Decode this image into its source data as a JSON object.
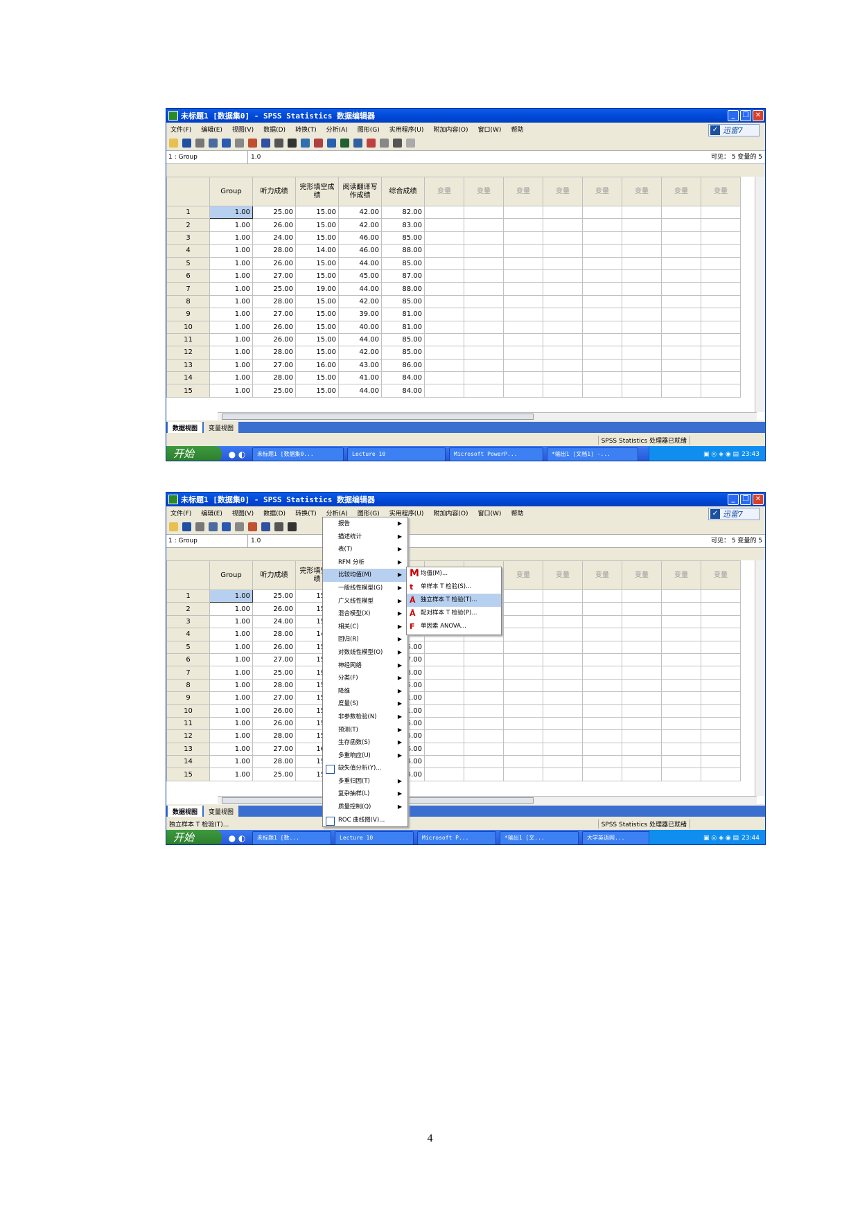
{
  "window": {
    "title": "未标题1 [数据集0] - SPSS Statistics 数据编辑器",
    "menu": [
      "文件(F)",
      "编辑(E)",
      "视图(V)",
      "数据(D)",
      "转换(T)",
      "分析(A)",
      "图形(G)",
      "实用程序(U)",
      "附加内容(O)",
      "窗口(W)",
      "帮助"
    ],
    "brand": "迅雷7",
    "cell_ref": "1 : Group",
    "cell_value": "1.0",
    "visible": "可见： 5 变量的 5",
    "columns": [
      "Group",
      "听力成绩",
      "完形填空成绩",
      "阅读翻译写作成绩",
      "综合成绩"
    ],
    "var_placeholder": "变量",
    "rows": [
      [
        "1",
        "1.00",
        "25.00",
        "15.00",
        "42.00",
        "82.00"
      ],
      [
        "2",
        "1.00",
        "26.00",
        "15.00",
        "42.00",
        "83.00"
      ],
      [
        "3",
        "1.00",
        "24.00",
        "15.00",
        "46.00",
        "85.00"
      ],
      [
        "4",
        "1.00",
        "28.00",
        "14.00",
        "46.00",
        "88.00"
      ],
      [
        "5",
        "1.00",
        "26.00",
        "15.00",
        "44.00",
        "85.00"
      ],
      [
        "6",
        "1.00",
        "27.00",
        "15.00",
        "45.00",
        "87.00"
      ],
      [
        "7",
        "1.00",
        "25.00",
        "19.00",
        "44.00",
        "88.00"
      ],
      [
        "8",
        "1.00",
        "28.00",
        "15.00",
        "42.00",
        "85.00"
      ],
      [
        "9",
        "1.00",
        "27.00",
        "15.00",
        "39.00",
        "81.00"
      ],
      [
        "10",
        "1.00",
        "26.00",
        "15.00",
        "40.00",
        "81.00"
      ],
      [
        "11",
        "1.00",
        "26.00",
        "15.00",
        "44.00",
        "85.00"
      ],
      [
        "12",
        "1.00",
        "28.00",
        "15.00",
        "42.00",
        "85.00"
      ],
      [
        "13",
        "1.00",
        "27.00",
        "16.00",
        "43.00",
        "86.00"
      ],
      [
        "14",
        "1.00",
        "28.00",
        "15.00",
        "41.00",
        "84.00"
      ],
      [
        "15",
        "1.00",
        "25.00",
        "15.00",
        "44.00",
        "84.00"
      ]
    ],
    "tabs": [
      "数据视图",
      "变量视图"
    ],
    "status_ready": "SPSS Statistics  处理器已就绪",
    "start": "开始"
  },
  "screen1": {
    "status_left": "",
    "tasks": [
      "未标题1 [数据集0...",
      "Lecture 10",
      "Microsoft PowerP...",
      "*输出1 [文档1] -..."
    ],
    "clock": "23:43"
  },
  "screen2": {
    "status_left": "独立样本 T 检验(T)...",
    "tasks": [
      "未标题1 [数...",
      "Lecture 10",
      "Microsoft P...",
      "*输出1 [文...",
      "大学英语网..."
    ],
    "clock": "23:44",
    "dropdown": [
      "报告",
      "描述统计",
      "表(T)",
      "RFM 分析",
      "比较均值(M)",
      "一般线性模型(G)",
      "广义线性模型",
      "混合模型(X)",
      "相关(C)",
      "回归(R)",
      "对数线性模型(O)",
      "神经网络",
      "分类(F)",
      "降维",
      "度量(S)",
      "非参数检验(N)",
      "预测(T)",
      "生存函数(S)",
      "多重响应(U)",
      "缺失值分析(Y)...",
      "多重归因(T)",
      "复杂抽样(L)",
      "质量控制(Q)",
      "ROC 曲线图(V)..."
    ],
    "submenu": [
      "均值(M)...",
      "单样本 T 检验(S)...",
      "独立样本 T 检验(T)...",
      "配对样本 T 检验(P)...",
      "单因素 ANOVA..."
    ],
    "submenu_icons": [
      "M",
      "t",
      "Å",
      "Å",
      "F"
    ]
  },
  "page_number": "4"
}
